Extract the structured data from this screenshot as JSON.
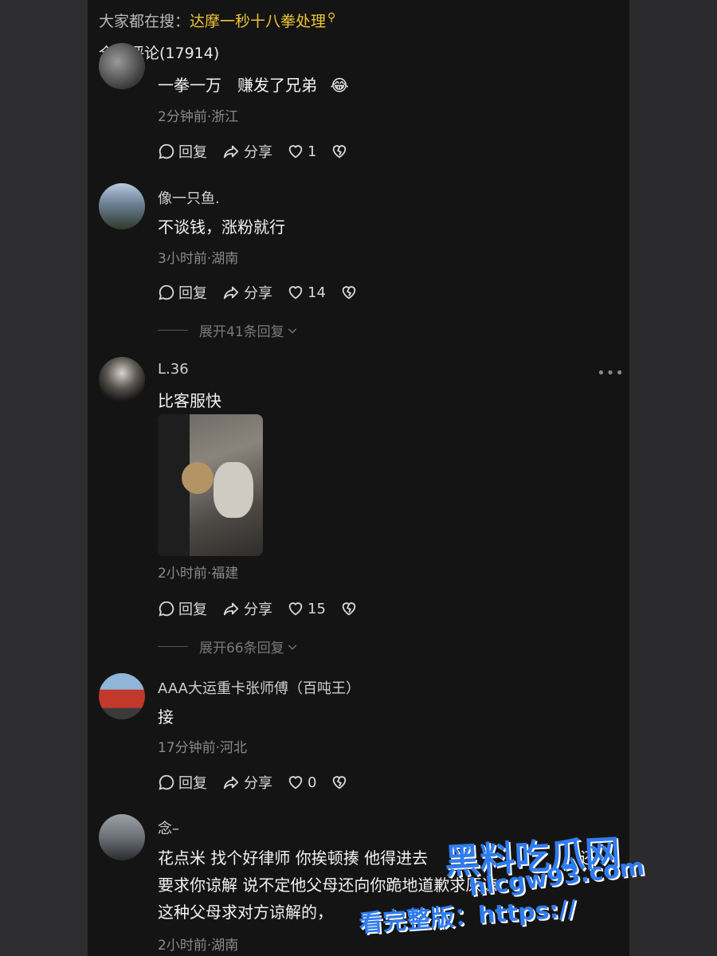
{
  "hot_search": {
    "prefix": "大家都在搜：",
    "keyword": "达摩一秒十八拳处理"
  },
  "comments_header": "全部评论(17914)",
  "comments": [
    {
      "content": "一拳一万　赚发了兄弟",
      "emoji": "😂",
      "meta": "2分钟前·浙江",
      "reply_label": "回复",
      "share_label": "分享",
      "likes": "1"
    },
    {
      "username": "像一只鱼.",
      "content": "不谈钱，涨粉就行",
      "meta": "3小时前·湖南",
      "reply_label": "回复",
      "share_label": "分享",
      "likes": "14",
      "expand_label": "展开41条回复"
    },
    {
      "username": "L.36",
      "content": "比客服快",
      "meta": "2小时前·福建",
      "reply_label": "回复",
      "share_label": "分享",
      "likes": "15",
      "expand_label": "展开66条回复"
    },
    {
      "username": "AAA大运重卡张师傅（百吨王）",
      "content": "接",
      "meta": "17分钟前·河北",
      "reply_label": "回复",
      "share_label": "分享",
      "likes": "0"
    },
    {
      "username": "念–",
      "content_line1": "花点米 找个好律师 你挨顿揍 他得进去",
      "content_line1_end": "还",
      "content_line2": "要求你谅解 说不定他父母还向你跪地道歉求原谅",
      "content_line3": "这种父母求对方谅解的，",
      "meta": "2小时前·湖南"
    }
  ],
  "more_label": "•••",
  "watermark": {
    "site_name": "黑料吃瓜网",
    "url": "hlcgw93.com",
    "label": "看完整版：https://"
  },
  "colors": {
    "accent_keyword": "#f0c533",
    "watermark": "#2f7cf0"
  }
}
